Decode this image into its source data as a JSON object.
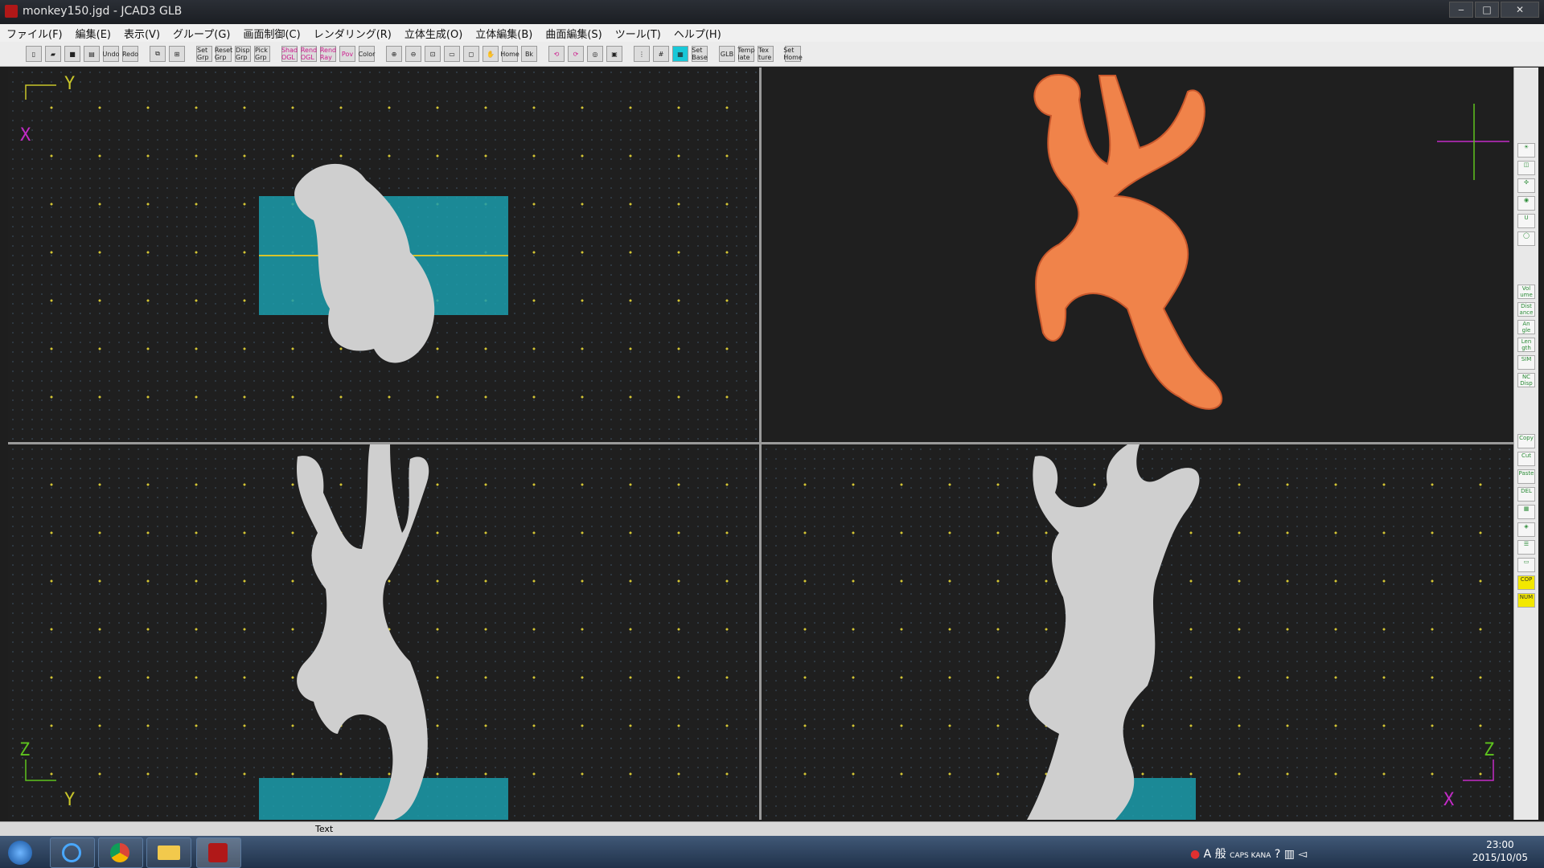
{
  "window": {
    "title": "monkey150.jgd - JCAD3 GLB",
    "minimize": "‒",
    "maximize": "□",
    "close": "✕"
  },
  "menu": [
    "ファイル(F)",
    "編集(E)",
    "表示(V)",
    "グループ(G)",
    "画面制御(C)",
    "レンダリング(R)",
    "立体生成(O)",
    "立体編集(B)",
    "曲面編集(S)",
    "ツール(T)",
    "ヘルプ(H)"
  ],
  "toolbar": {
    "buttons": [
      "Undo",
      "Redo",
      "Set Grp",
      "Reset Grp",
      "Disp Grp",
      "Pick Grp",
      "Shad OGL",
      "Rend OGL",
      "Rend Ray",
      "Pov",
      "Color",
      "Home",
      "Bk",
      "Set Base",
      "GLB",
      "Temp late",
      "Tex ture",
      "Set Home"
    ]
  },
  "viewports": {
    "top": {
      "axis_h": "Y",
      "axis_v": "X"
    },
    "perspective": {},
    "front": {
      "axis_v": "Z",
      "axis_h": "Y"
    },
    "side": {
      "axis_v": "Z",
      "axis_h": "X"
    }
  },
  "right_tools": [
    "Vol ume",
    "Dist ance",
    "An gle",
    "Len gth",
    "SIM",
    "NC Disp",
    "Copy",
    "Cut",
    "Paste",
    "DEL",
    "COP",
    "NUM"
  ],
  "bottom_toolbar": {
    "text_button": "Text"
  },
  "taskbar": {
    "clock_time": "23:00",
    "clock_date": "2015/10/05",
    "ime": "A 般",
    "caps": "CAPS KANA"
  },
  "colors": {
    "accent_cyan": "#18c8d8",
    "model_orange": "#f0834a",
    "grid_dot": "#d4c534",
    "axis_green": "#5ec41e",
    "axis_magenta": "#c32bc7"
  }
}
